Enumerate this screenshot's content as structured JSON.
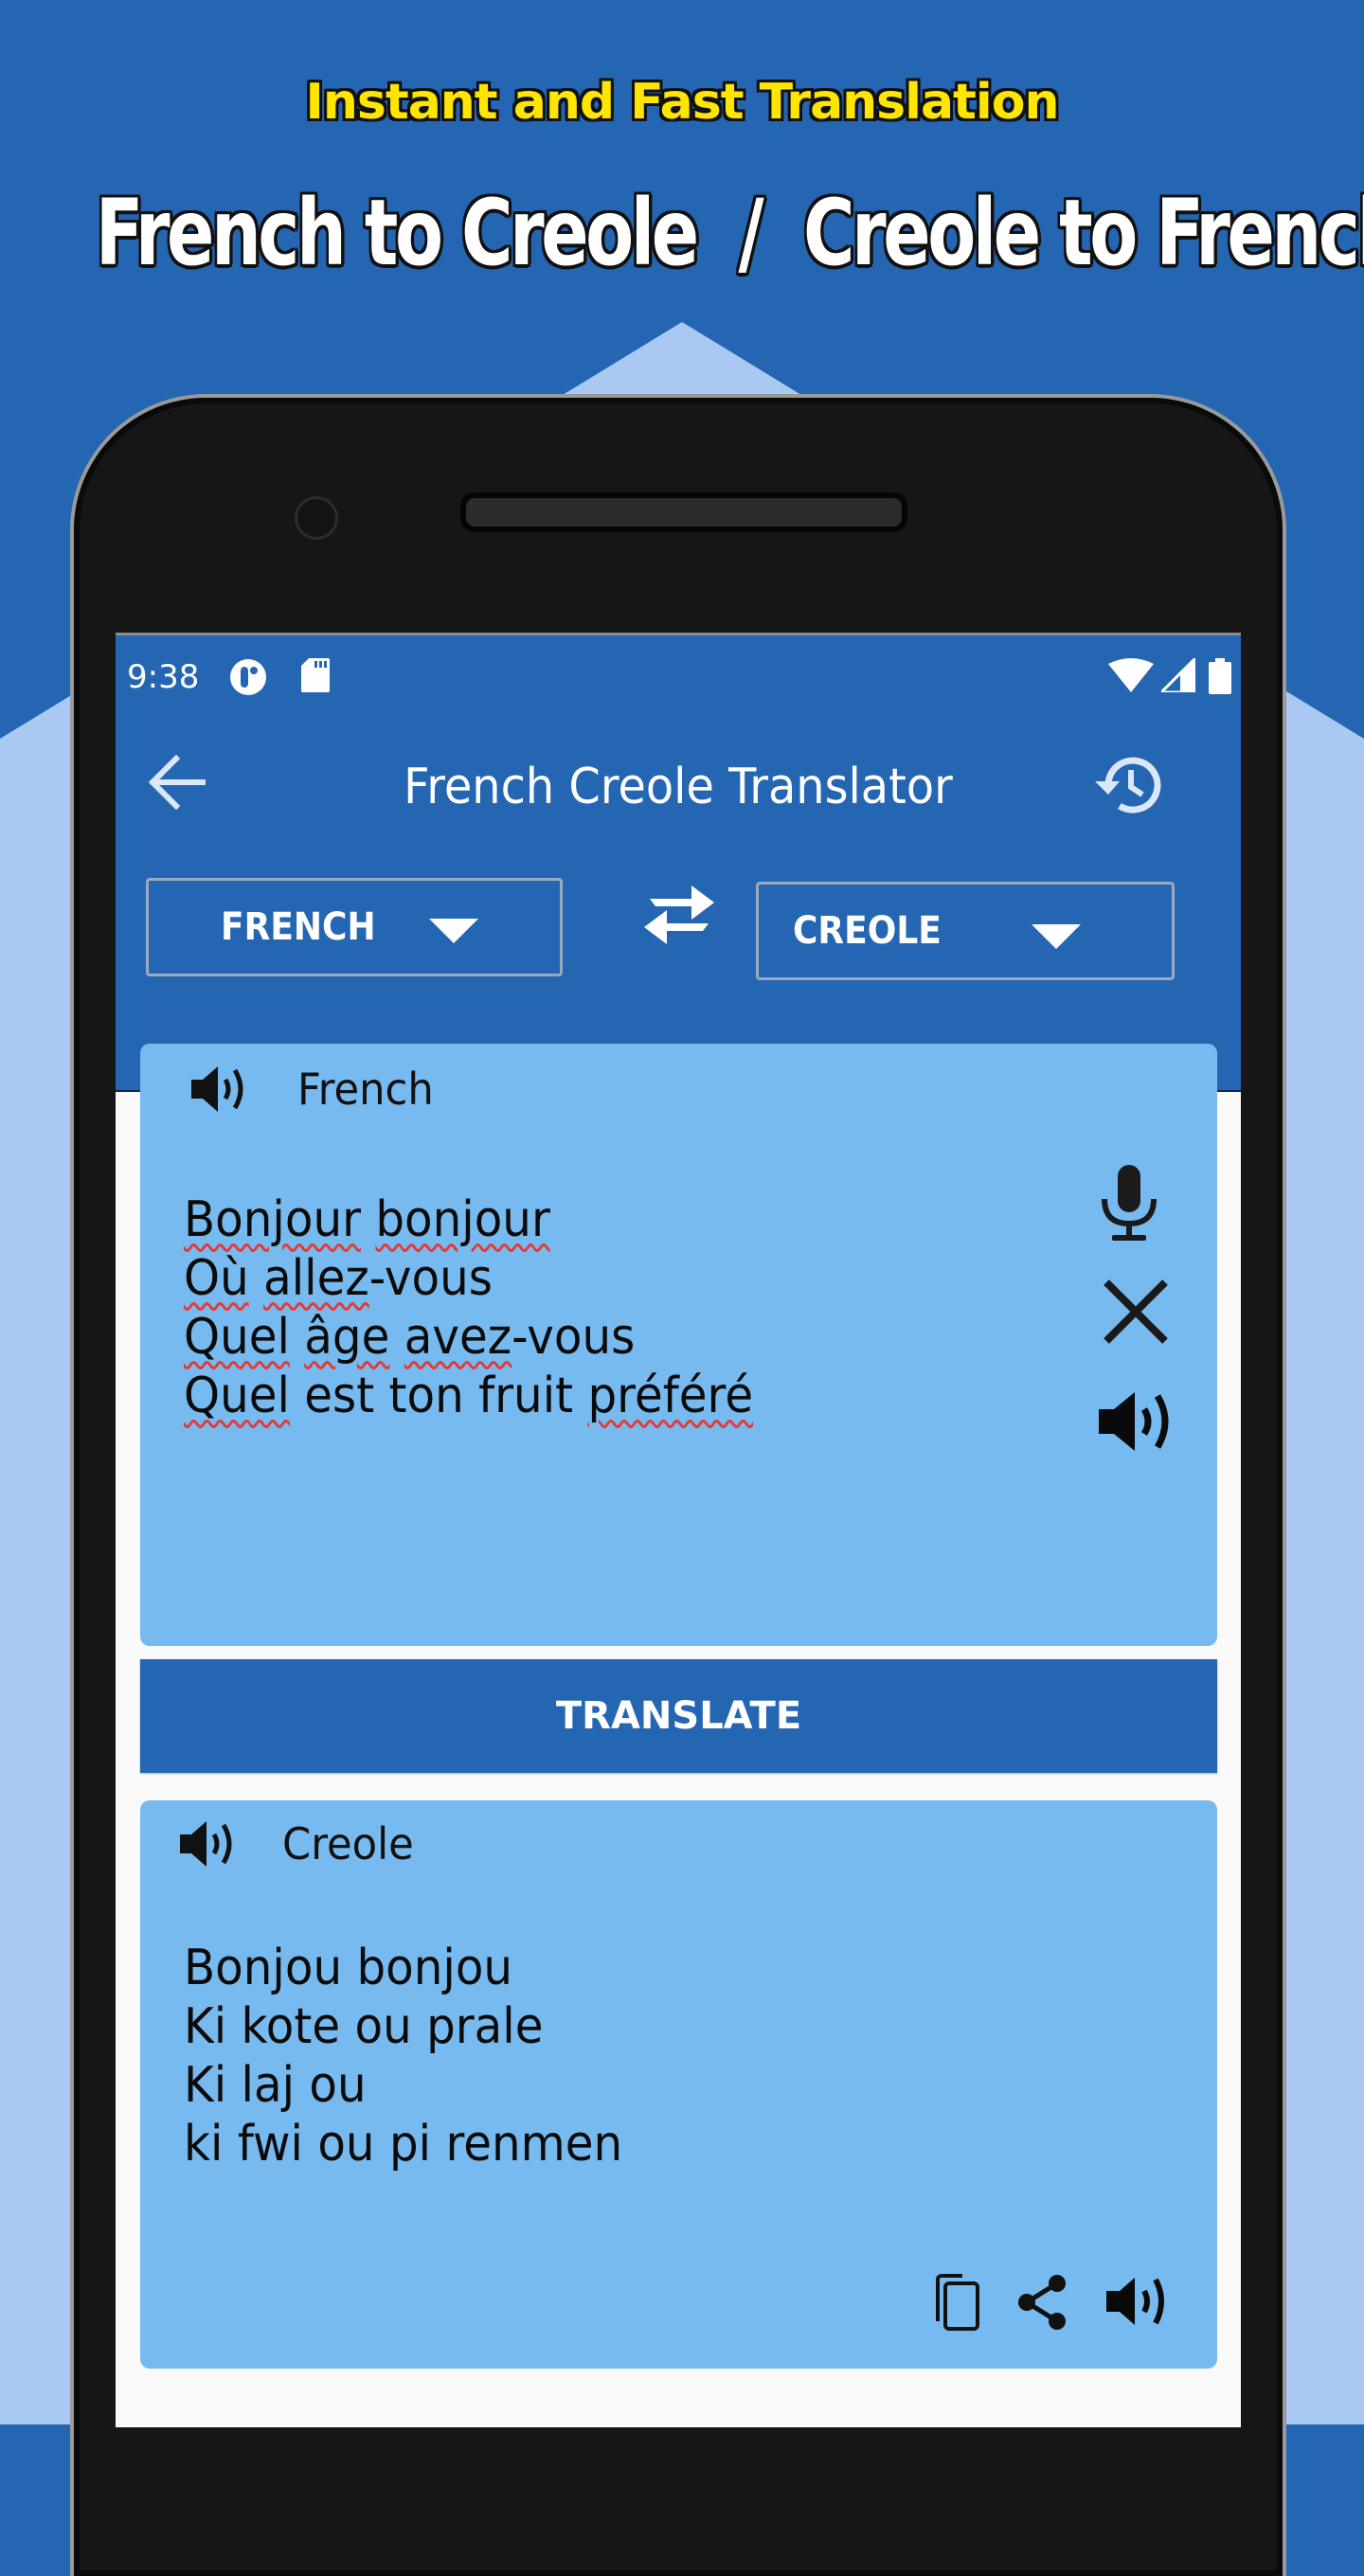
{
  "promo": {
    "tagline": "Instant and Fast Translation",
    "headline": "French to Creole  /  Creole to French"
  },
  "status_bar": {
    "time": "9:38",
    "icons": [
      "notification-app-icon",
      "sd-card-icon",
      "wifi-icon",
      "signal-icon",
      "battery-icon"
    ]
  },
  "app_bar": {
    "title": "French Creole Translator",
    "back_icon": "arrow-left-icon",
    "history_icon": "history-icon"
  },
  "languages": {
    "source": "FRENCH",
    "target": "CREOLE",
    "swap_icon": "swap-arrows-icon"
  },
  "input_card": {
    "language_label": "French",
    "text_lines": [
      [
        {
          "t": "Bonjour",
          "err": true
        },
        {
          "t": " ",
          "err": false
        },
        {
          "t": "bonjour",
          "err": true
        }
      ],
      [
        {
          "t": "Où",
          "err": true
        },
        {
          "t": " ",
          "err": false
        },
        {
          "t": "allez",
          "err": true
        },
        {
          "t": "-vous",
          "err": false
        }
      ],
      [
        {
          "t": "Quel",
          "err": true
        },
        {
          "t": " ",
          "err": false
        },
        {
          "t": "âge",
          "err": true
        },
        {
          "t": " ",
          "err": false
        },
        {
          "t": "avez",
          "err": true
        },
        {
          "t": "-vous",
          "err": false
        }
      ],
      [
        {
          "t": "Quel",
          "err": true
        },
        {
          "t": " est ton fruit ",
          "err": false
        },
        {
          "t": "préféré",
          "err": true
        }
      ]
    ],
    "actions": [
      "microphone-icon",
      "clear-icon",
      "speaker-icon"
    ]
  },
  "translate_button": {
    "label": "TRANSLATE"
  },
  "output_card": {
    "language_label": "Creole",
    "text_lines": [
      "Bonjou bonjou",
      "Ki kote ou prale",
      "Ki laj ou",
      "ki fwi ou pi renmen"
    ],
    "actions": [
      "copy-icon",
      "share-icon",
      "speaker-icon"
    ]
  },
  "colors": {
    "primary": "#2566B3",
    "background_light": "#A9C9F2",
    "card": "#77BAEF",
    "tagline": "#FFE600",
    "spellcheck": "#E53935"
  }
}
